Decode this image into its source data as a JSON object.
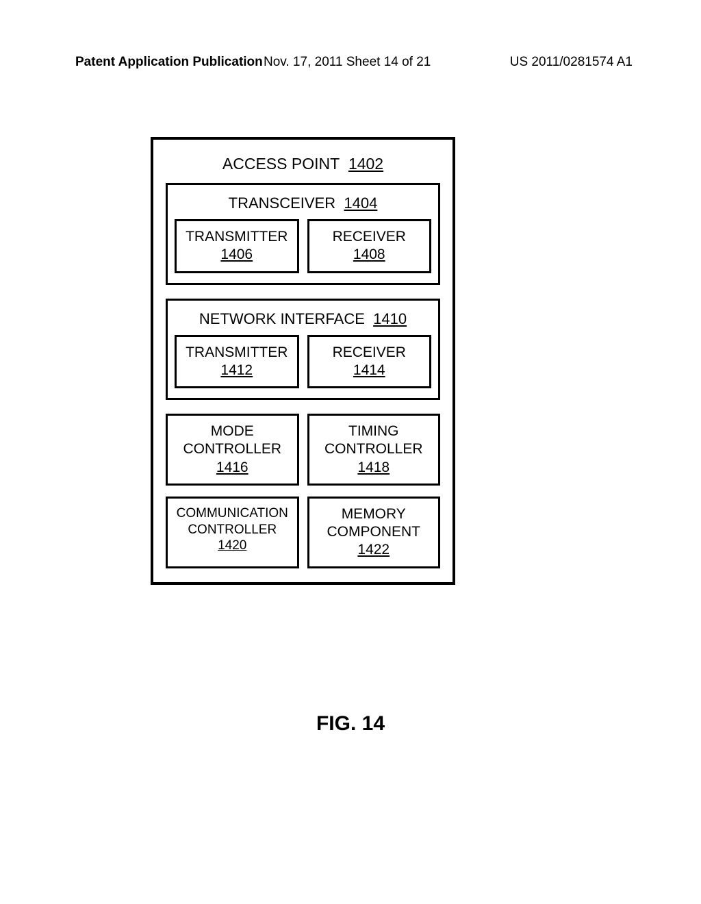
{
  "header": {
    "left": "Patent Application Publication",
    "mid": "Nov. 17, 2011  Sheet 14 of 21",
    "right": "US 2011/0281574 A1"
  },
  "diagram": {
    "title": "ACCESS POINT",
    "title_ref": "1402",
    "transceiver": {
      "title": "TRANSCEIVER",
      "title_ref": "1404",
      "tx_label": "TRANSMITTER",
      "tx_ref": "1406",
      "rx_label": "RECEIVER",
      "rx_ref": "1408"
    },
    "netif": {
      "title": "NETWORK INTERFACE",
      "title_ref": "1410",
      "tx_label": "TRANSMITTER",
      "tx_ref": "1412",
      "rx_label": "RECEIVER",
      "rx_ref": "1414"
    },
    "row3": {
      "mode_l1": "MODE",
      "mode_l2": "CONTROLLER",
      "mode_ref": "1416",
      "timing_l1": "TIMING",
      "timing_l2": "CONTROLLER",
      "timing_ref": "1418"
    },
    "row4": {
      "comm_l1": "COMMUNICATION",
      "comm_l2": "CONTROLLER",
      "comm_ref": "1420",
      "mem_l1": "MEMORY",
      "mem_l2": "COMPONENT",
      "mem_ref": "1422"
    }
  },
  "figure_label": "FIG. 14"
}
